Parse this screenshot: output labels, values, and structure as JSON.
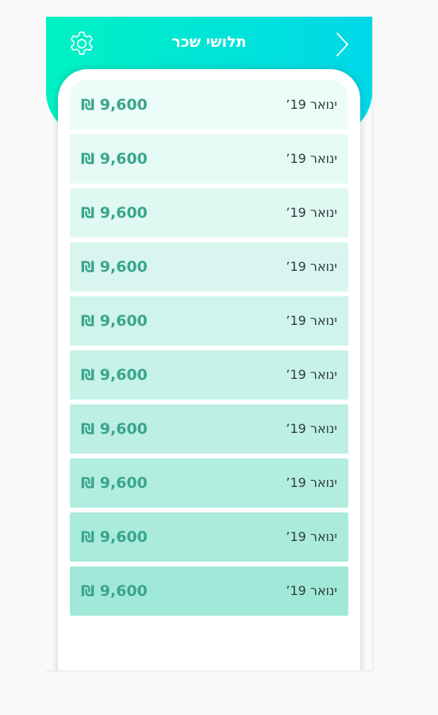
{
  "header": {
    "title": "תלושי שכר",
    "icon_color": "#ffffff",
    "gradient": [
      "#00f2c3",
      "#00d8e9"
    ]
  },
  "icons": {
    "settings": "gear-icon",
    "back": "chevron-right-icon"
  },
  "accent_color": "#3aa58d",
  "rows": [
    {
      "month": "ינואר 19’",
      "amount": "₪ 9,600",
      "bg": "#ecfcf8"
    },
    {
      "month": "ינואר 19’",
      "amount": "₪ 9,600",
      "bg": "#e6faf5"
    },
    {
      "month": "ינואר 19’",
      "amount": "₪ 9,600",
      "bg": "#e0f8f2"
    },
    {
      "month": "ינואר 19’",
      "amount": "₪ 9,600",
      "bg": "#d8f6ef"
    },
    {
      "month": "ינואר 19’",
      "amount": "₪ 9,600",
      "bg": "#cff4eb"
    },
    {
      "month": "ינואר 19’",
      "amount": "₪ 9,600",
      "bg": "#c6f2e8"
    },
    {
      "month": "ינואר 19’",
      "amount": "₪ 9,600",
      "bg": "#bdefe4"
    },
    {
      "month": "ינואר 19’",
      "amount": "₪ 9,600",
      "bg": "#b3ede0"
    },
    {
      "month": "ינואר 19’",
      "amount": "₪ 9,600",
      "bg": "#aaebdc"
    },
    {
      "month": "ינואר 19’",
      "amount": "₪ 9,600",
      "bg": "#a0e9d8"
    }
  ]
}
